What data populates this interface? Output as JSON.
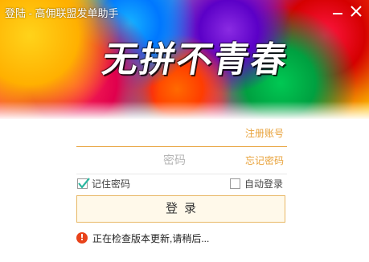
{
  "window": {
    "title": "登陆 - 高佣联盟发单助手",
    "minimize_label": "",
    "close_label": ""
  },
  "banner": {
    "slogan": "无拼不青春"
  },
  "form": {
    "account": {
      "value": "",
      "placeholder": "",
      "link": "注册账号"
    },
    "password": {
      "value": "",
      "placeholder": "密码",
      "link": "忘记密码"
    },
    "remember_password": {
      "label": "记住密码",
      "checked": true
    },
    "auto_login": {
      "label": "自动登录",
      "checked": false
    },
    "login_button": "登录",
    "status": {
      "icon": "!",
      "text": "正在检查版本更新,请稍后..."
    }
  },
  "colors": {
    "accent": "#e8a23a",
    "button_bg": "#fff9ea",
    "check": "#2db7a0",
    "error": "#e8421a"
  },
  "icons": {
    "minimize": "minimize-icon",
    "close": "close-icon",
    "check": "checkmark-icon",
    "status": "warning-icon"
  }
}
